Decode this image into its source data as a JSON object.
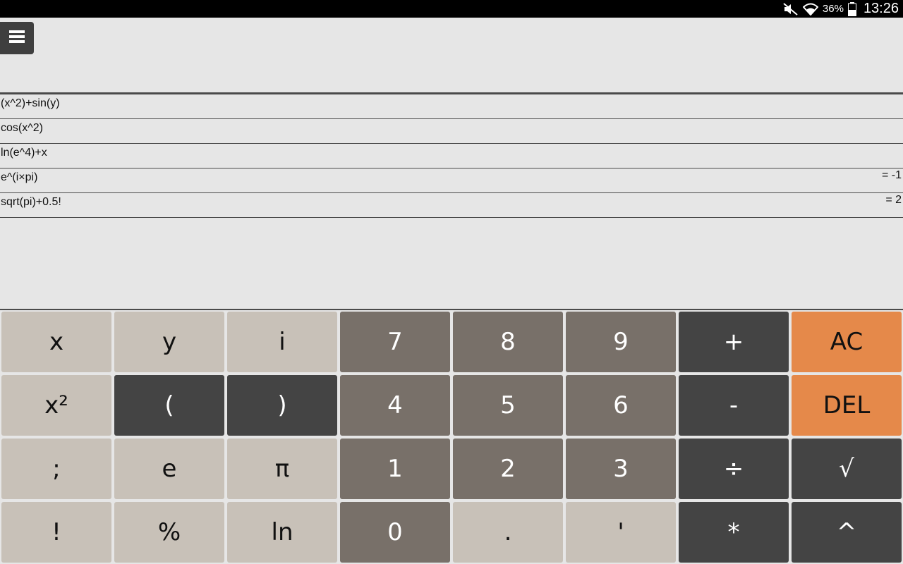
{
  "status_bar": {
    "battery_percent": "36%",
    "time": "13:26",
    "icons": [
      "mute-icon",
      "wifi-icon",
      "battery-icon"
    ]
  },
  "toolbar": {
    "menu_icon": "hamburger-menu-icon"
  },
  "history": [
    {
      "expression": "(x^2)+sin(y)",
      "result": ""
    },
    {
      "expression": "cos(x^2)",
      "result": ""
    },
    {
      "expression": "ln(e^4)+x",
      "result": ""
    },
    {
      "expression": "e^(i×pi)",
      "result": "= -1"
    },
    {
      "expression": "sqrt(pi)+0.5!",
      "result": "= 2"
    }
  ],
  "keys": {
    "r0": [
      "x",
      "y",
      "i",
      "7",
      "8",
      "9",
      "+",
      "AC"
    ],
    "r1": [
      "x²",
      "(",
      ")",
      "4",
      "5",
      "6",
      "-",
      "DEL"
    ],
    "r2": [
      ";",
      "e",
      "π",
      "1",
      "2",
      "3",
      "÷",
      "√"
    ],
    "r3": [
      "!",
      "%",
      "ln",
      "0",
      ".",
      "'",
      "*",
      "^"
    ]
  },
  "colors": {
    "background": "#e6e6e6",
    "key_light": "#c8c1b8",
    "key_number": "#787069",
    "key_operator": "#444444",
    "key_clear": "#e5894a",
    "status_bar": "#000000"
  }
}
